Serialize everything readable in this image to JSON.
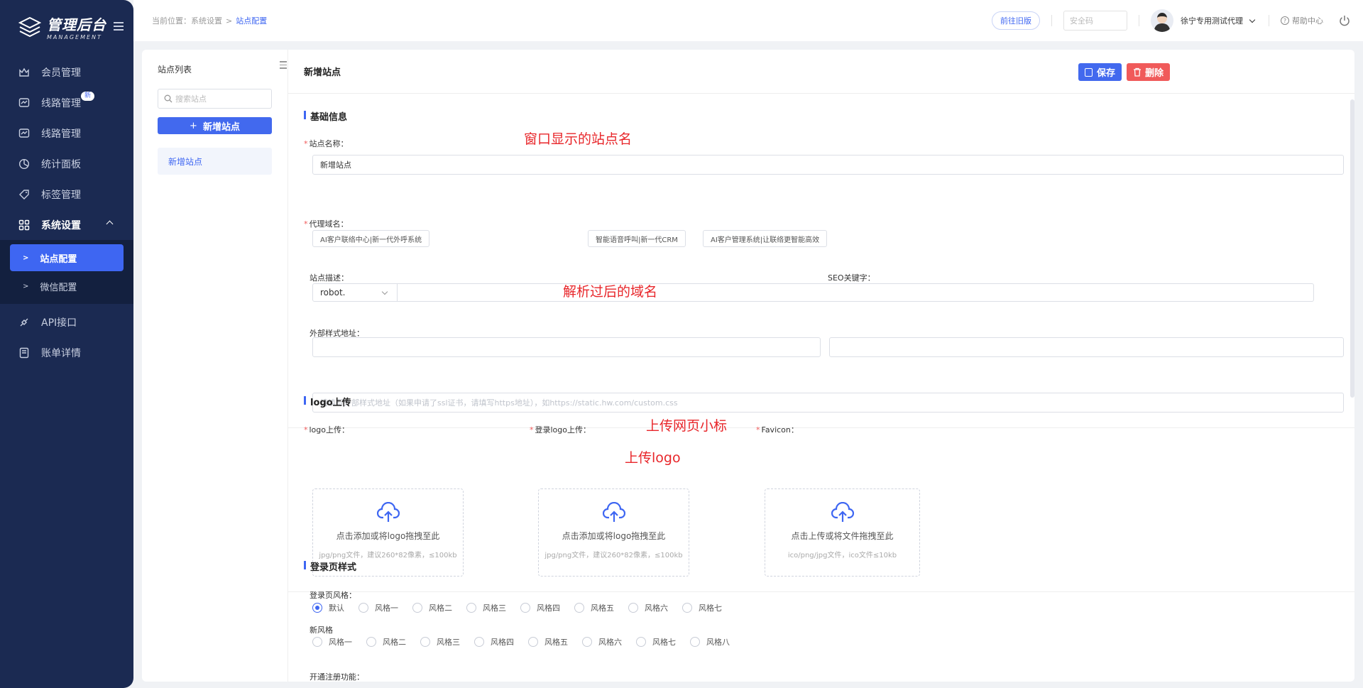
{
  "sidebar": {
    "logo_title": "管理后台",
    "logo_sub": "MANAGEMENT",
    "items": [
      {
        "label": "会员管理",
        "icon": "member-icon"
      },
      {
        "label": "线路管理",
        "icon": "route-icon",
        "badge": "新"
      },
      {
        "label": "线路管理",
        "icon": "route-icon"
      },
      {
        "label": "统计面板",
        "icon": "pie-chart-icon"
      },
      {
        "label": "标签管理",
        "icon": "tag-icon"
      },
      {
        "label": "系统设置",
        "icon": "grid-icon"
      }
    ],
    "sub_items": [
      {
        "label": "站点配置"
      },
      {
        "label": "微信配置"
      }
    ],
    "items_after": [
      {
        "label": "API接口",
        "icon": "api-icon"
      },
      {
        "label": "账单详情",
        "icon": "bill-icon"
      }
    ]
  },
  "header": {
    "breadcrumb": {
      "prefix": "当前位置：",
      "parent": "系统设置",
      "sep": ">",
      "current": "站点配置"
    },
    "old_version": "前往旧版",
    "security_placeholder": "安全码",
    "user_name": "徐宁专用测试代理",
    "help": "帮助中心"
  },
  "site_panel": {
    "title": "站点列表",
    "search_placeholder": "搜索站点",
    "add_button": "新增站点",
    "sites": [
      "新增站点"
    ]
  },
  "form": {
    "title": "新增站点",
    "save": "保存",
    "delete": "删除",
    "basic_section": "基础信息",
    "site_name_label": "站点名称：",
    "site_name_value": "新增站点",
    "tags": [
      "AI客户联络中心|新一代外呼系统",
      "智能语音呼叫|新一代CRM",
      "AI客户管理系统|让联络更智能高效"
    ],
    "domain_label": "代理域名：",
    "domain_prefix": "robot.",
    "desc_label": "站点描述：",
    "seo_label": "SEO关键字：",
    "css_label": "外部样式地址：",
    "css_placeholder": "请填写外部样式地址（如果申请了ssl证书，请填写https地址），如https://static.hw.com/custom.css",
    "logo_section": "logo上传",
    "logo_label": "logo上传：",
    "login_logo_label": "登录logo上传：",
    "favicon_label": "Favicon：",
    "uploads": [
      {
        "main": "点击添加或将logo拖拽至此",
        "hint": "jpg/png文件，建议260*82像素，≤100kb"
      },
      {
        "main": "点击添加或将logo拖拽至此",
        "hint": "jpg/png文件，建议260*82像素，≤100kb"
      },
      {
        "main": "点击上传或将文件拖拽至此",
        "hint": "ico/png/jpg文件，ico文件≤10kb"
      }
    ],
    "login_section": "登录页样式",
    "login_style_label": "登录页风格：",
    "login_styles": [
      "默认",
      "风格一",
      "风格二",
      "风格三",
      "风格四",
      "风格五",
      "风格六",
      "风格七"
    ],
    "new_style_label": "新风格",
    "new_styles": [
      "风格一",
      "风格二",
      "风格三",
      "风格四",
      "风格五",
      "风格六",
      "风格七",
      "风格八"
    ],
    "register_label": "开通注册功能："
  },
  "annotations": {
    "site_name": "窗口显示的站点名",
    "domain": "解析过后的域名",
    "logo": "上传logo",
    "favicon": "上传网页小标"
  },
  "colors": {
    "sidebar_bg": "#1b2a52",
    "accent": "#3e66f2",
    "danger": "#f05a5a",
    "annotation": "#e8262a"
  }
}
